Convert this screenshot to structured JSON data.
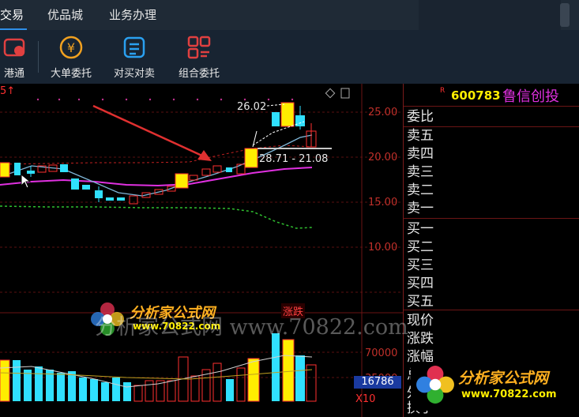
{
  "top_nav": {
    "tabs": [
      "交易",
      "优品城",
      "业务办理"
    ]
  },
  "toolbar": {
    "items": [
      {
        "label": "港通",
        "icon": "hk-connect-icon",
        "color": "#e04040"
      },
      {
        "label": "大单委托",
        "icon": "yuan-coin-icon",
        "color": "#f0a020"
      },
      {
        "label": "对买对卖",
        "icon": "exchange-icon",
        "color": "#2aa0f0"
      },
      {
        "label": "组合委托",
        "icon": "grid-order-icon",
        "color": "#e04040"
      }
    ]
  },
  "chart": {
    "corner_label": "5↑",
    "high_annot": "26.02",
    "range_annot": "28.71 - 21.08",
    "y_ticks": [
      "25.00",
      "20.00",
      "15.00",
      "10.00"
    ],
    "vol_ticks": [
      "70000",
      "35000"
    ],
    "vol_highlight": "16786",
    "vol_unit": "X10",
    "zd_label": "涨跌"
  },
  "stock": {
    "code": "600783",
    "name": "鲁信创投",
    "prefix": "R"
  },
  "order_book": {
    "rows": [
      "委比",
      "卖五",
      "卖四",
      "卖三",
      "卖二",
      "卖一",
      "买一",
      "买二",
      "买三",
      "买四",
      "买五",
      "现价",
      "涨跌",
      "涨幅",
      "总量",
      "外盘",
      "换手"
    ]
  },
  "watermark": {
    "site": "分析家公式网",
    "url": "www.70822.com",
    "overlay_text": "分析家公式网 www.70822.com"
  },
  "colors": {
    "up": "#ff3030",
    "down": "#30e0ff",
    "ma_white": "#d0d0d0",
    "ma_magenta": "#e030e0",
    "ma_green": "#30c030",
    "accent_yellow": "#ffee00"
  }
}
